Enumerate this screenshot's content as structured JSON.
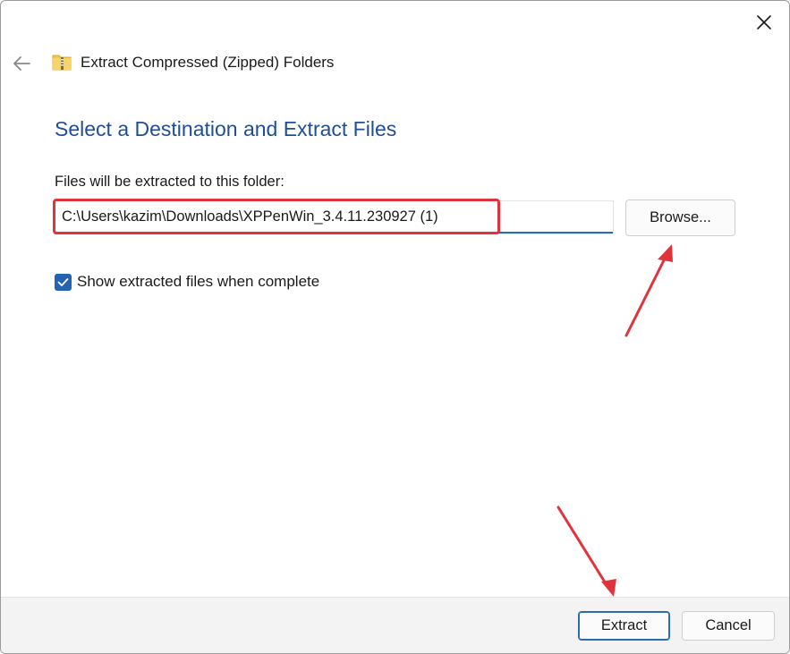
{
  "window": {
    "title": "Extract Compressed (Zipped) Folders"
  },
  "main": {
    "heading": "Select a Destination and Extract Files",
    "path_label": "Files will be extracted to this folder:",
    "path_value": "C:\\Users\\kazim\\Downloads\\XPPenWin_3.4.11.230927 (1)",
    "browse_label": "Browse...",
    "show_files_label": "Show extracted files when complete",
    "show_files_checked": true
  },
  "footer": {
    "extract_label": "Extract",
    "cancel_label": "Cancel"
  },
  "icons": {
    "back": "arrow-left-icon",
    "folder": "zipped-folder-icon",
    "close": "close-icon",
    "check": "checkmark-icon"
  },
  "colors": {
    "heading": "#1f4e99",
    "accent": "#2463b4",
    "annotation": "#e0343c"
  }
}
